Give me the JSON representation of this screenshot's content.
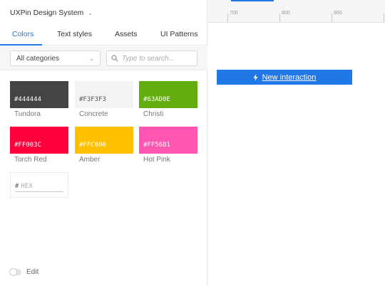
{
  "panel": {
    "title": "UXPin Design System",
    "tabs": [
      {
        "label": "Colors",
        "active": true
      },
      {
        "label": "Text styles",
        "active": false
      },
      {
        "label": "Assets",
        "active": false
      },
      {
        "label": "UI Patterns",
        "active": false
      }
    ],
    "category_select": {
      "value": "All categories"
    },
    "search": {
      "placeholder": "Type to search..."
    }
  },
  "colors": [
    {
      "hex": "#444444",
      "name": "Tundora",
      "color": "#444444",
      "text_color": "#ffffff"
    },
    {
      "hex": "#F3F3F3",
      "name": "Concrete",
      "color": "#F3F3F3",
      "text_color": "#555555"
    },
    {
      "hex": "#63AD0E",
      "name": "Christi",
      "color": "#63AD0E",
      "text_color": "#ffffff"
    },
    {
      "hex": "#FF003C",
      "name": "Torch Red",
      "color": "#FF003C",
      "text_color": "#ffffff"
    },
    {
      "hex": "#FFC000",
      "name": "Amber",
      "color": "#FFC000",
      "text_color": "#ffffff"
    },
    {
      "hex": "#FF56B1",
      "name": "Hot Pink",
      "color": "#FF56B1",
      "text_color": "#ffffff"
    }
  ],
  "hex_input": {
    "prefix": "#",
    "placeholder": "HEX"
  },
  "edit": {
    "label": "Edit"
  },
  "ruler": {
    "labels": [
      "700",
      "800",
      "900"
    ]
  },
  "interaction": {
    "label": "New interaction",
    "icon": "lightning-icon"
  },
  "accent_color": "#1f78e5"
}
